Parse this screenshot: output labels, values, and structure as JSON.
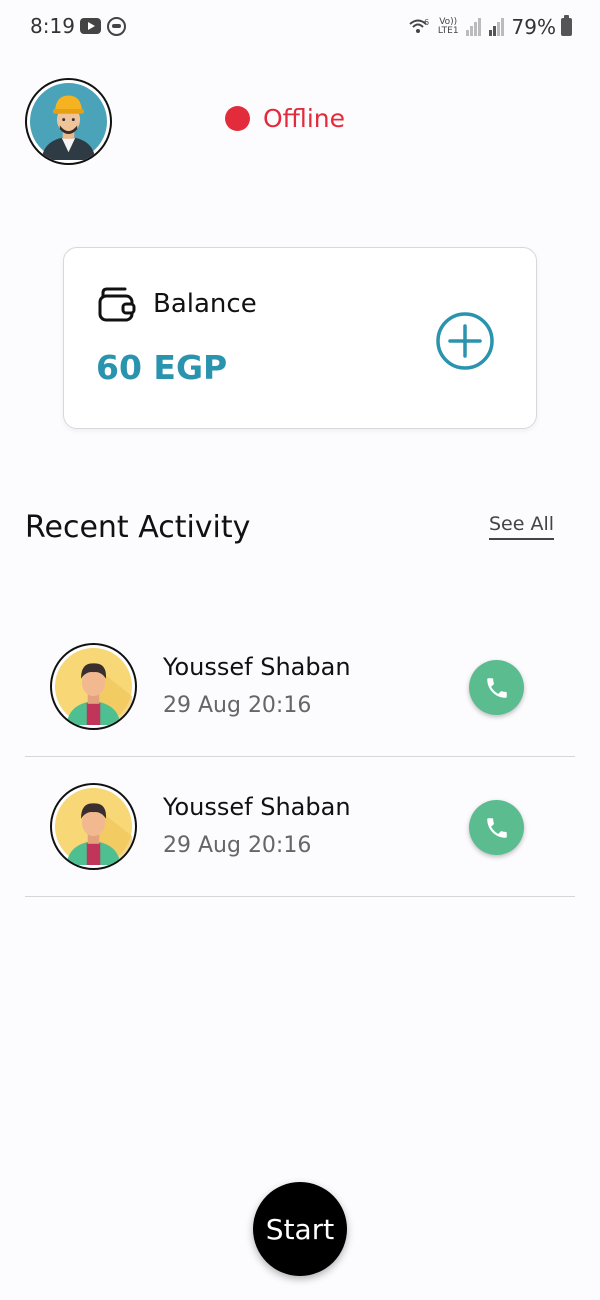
{
  "status_bar": {
    "time": "8:19",
    "network_top": "Vo))",
    "network_bottom": "LTE1",
    "wifi_label": "6",
    "battery": "79%",
    "icons": [
      "youtube-icon",
      "app-notification-icon",
      "wifi-icon",
      "signal-icon",
      "battery-icon"
    ]
  },
  "header": {
    "avatar_icon": "worker-avatar",
    "status_label": "Offline",
    "status_color": "#e22c3c"
  },
  "balance_card": {
    "icon": "wallet-icon",
    "label": "Balance",
    "amount": "60 EGP",
    "amount_color": "#2a93ad",
    "add_icon": "plus-circle-icon"
  },
  "recent_activity": {
    "title": "Recent Activity",
    "see_all_label": "See All",
    "items": [
      {
        "name": "Youssef Shaban",
        "time": "29 Aug 20:16",
        "avatar_icon": "user-avatar",
        "action_icon": "phone-icon"
      },
      {
        "name": "Youssef Shaban",
        "time": "29 Aug 20:16",
        "avatar_icon": "user-avatar",
        "action_icon": "phone-icon"
      }
    ]
  },
  "start_button": {
    "label": "Start"
  },
  "colors": {
    "accent": "#2a93ad",
    "call_button": "#5bbd8f",
    "offline": "#e22c3c",
    "start_button": "#000000"
  }
}
